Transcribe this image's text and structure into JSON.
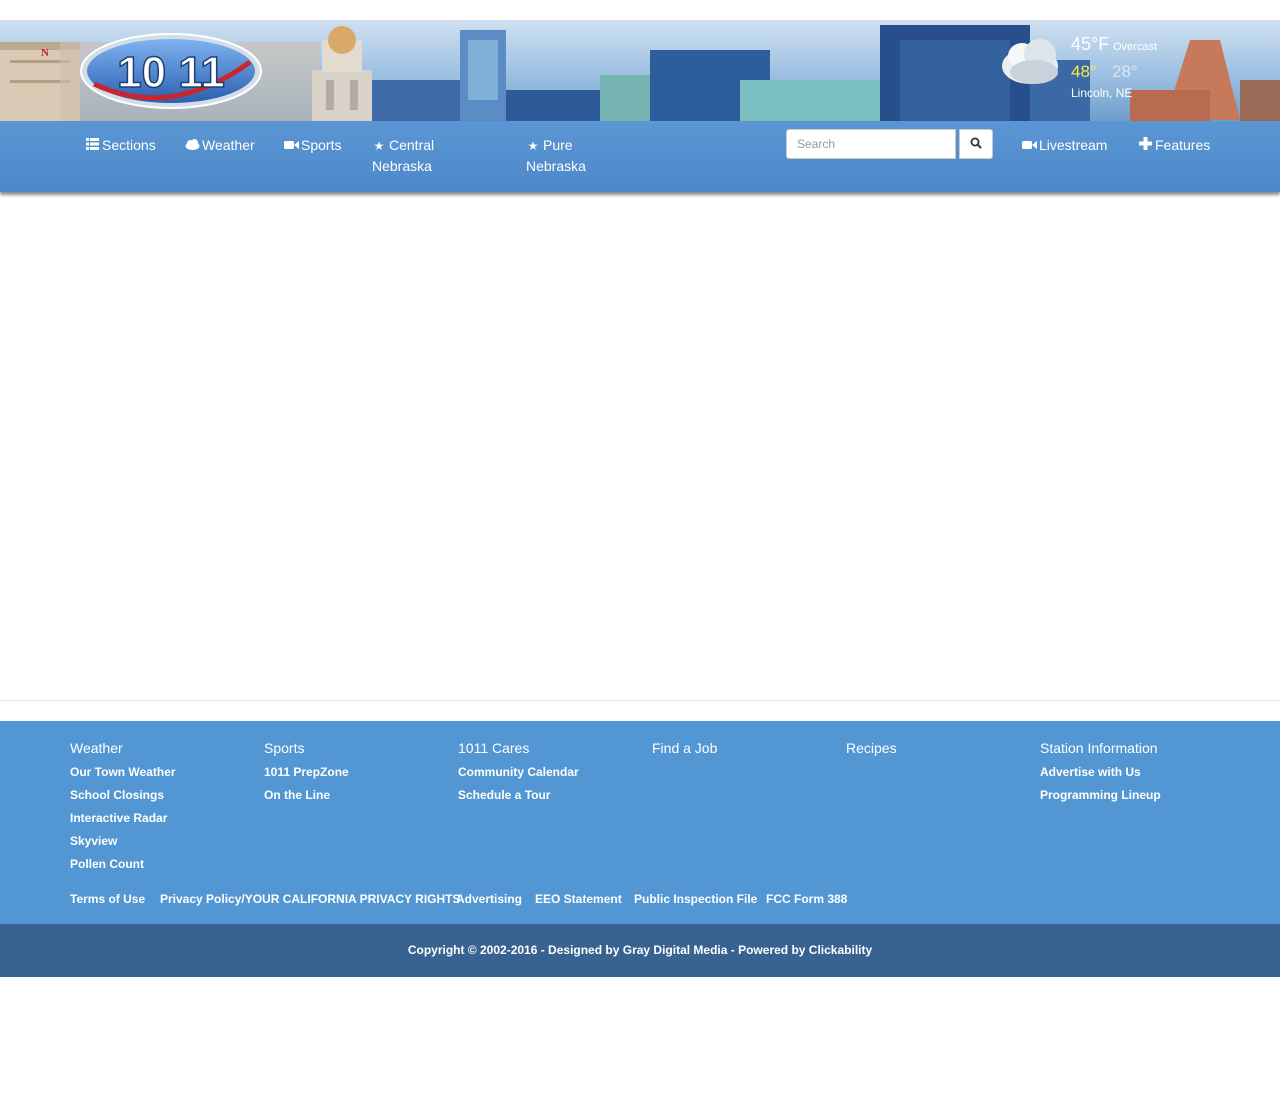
{
  "brand": {
    "logo_text": "10 11"
  },
  "weather": {
    "current_temp": "45°F",
    "condition": "Overcast",
    "high": "48°",
    "low": "28°",
    "location": "Lincoln, NE"
  },
  "nav": {
    "items": [
      {
        "label": "Sections",
        "icon": "list-icon"
      },
      {
        "label": "Weather",
        "icon": "cloud-icon"
      },
      {
        "label": "Sports",
        "icon": "video-camera-icon"
      },
      {
        "label": "Central Nebraska",
        "icon": "star-icon"
      },
      {
        "label": "Pure Nebraska",
        "icon": "star-icon"
      },
      {
        "label": "Livestream",
        "icon": "video-camera-icon"
      },
      {
        "label": "Features",
        "icon": "plus-icon"
      }
    ],
    "search_placeholder": "Search"
  },
  "footer": {
    "columns": [
      {
        "title": "Weather",
        "links": [
          "Our Town Weather",
          "School Closings",
          "Interactive Radar",
          "Skyview",
          "Pollen Count"
        ]
      },
      {
        "title": "Sports",
        "links": [
          "1011 PrepZone",
          "On the Line"
        ]
      },
      {
        "title": "1011 Cares",
        "links": [
          "Community Calendar",
          "Schedule a Tour"
        ]
      },
      {
        "title": "Find a Job",
        "links": []
      },
      {
        "title": "Recipes",
        "links": []
      },
      {
        "title": "Station Information",
        "links": [
          "Advertise with Us",
          "Programming Lineup"
        ]
      }
    ],
    "legal_links": [
      "Terms of Use",
      "Privacy Policy/YOUR CALIFORNIA PRIVACY RIGHTS",
      "Advertising",
      "EEO Statement",
      "Public Inspection File",
      "FCC Form 388"
    ],
    "copyright_prefix": "Copyright © 2002-2016 - Designed by ",
    "designer": "Gray Digital Media",
    "powered_prefix": " - Powered by ",
    "powered_by": "Clickability"
  },
  "colors": {
    "nav_bg": "#5b96d4",
    "footer_bg": "#5297d3",
    "copyright_bg": "#386390",
    "high_temp": "#f4ea4c"
  }
}
